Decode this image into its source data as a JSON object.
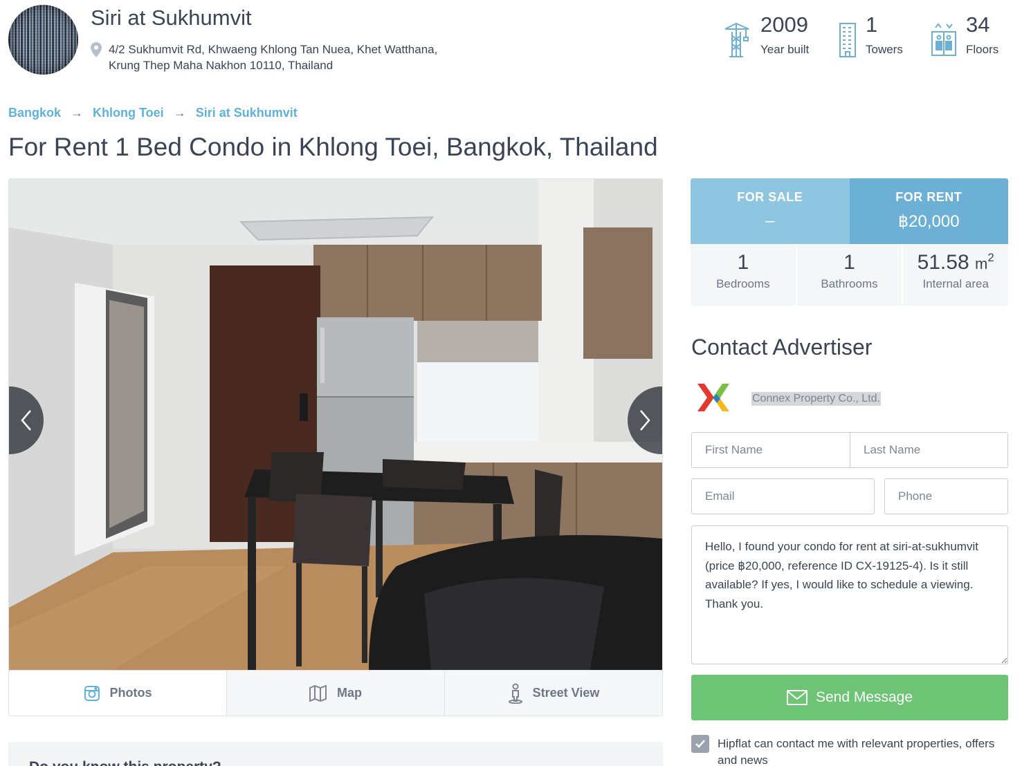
{
  "project": {
    "title": "Siri at Sukhumvit",
    "address_line1": "4/2 Sukhumvit Rd, Khwaeng Khlong Tan Nuea, Khet Watthana,",
    "address_line2": "Krung Thep Maha Nakhon 10110, Thailand"
  },
  "stats": [
    {
      "icon": "crane-icon",
      "value": "2009",
      "label": "Year built"
    },
    {
      "icon": "tower-icon",
      "value": "1",
      "label": "Towers"
    },
    {
      "icon": "elevator-icon",
      "value": "34",
      "label": "Floors"
    }
  ],
  "breadcrumb": {
    "items": [
      "Bangkok",
      "Khlong Toei",
      "Siri at Sukhumvit"
    ],
    "separator": "→"
  },
  "page_title": "For Rent 1 Bed Condo in Khlong Toei, Bangkok, Thailand",
  "gallery": {
    "tabs": [
      {
        "label": "Photos",
        "icon": "camera-icon"
      },
      {
        "label": "Map",
        "icon": "map-icon"
      },
      {
        "label": "Street View",
        "icon": "pegman-icon"
      }
    ]
  },
  "know_box": {
    "title": "Do you know this property?"
  },
  "pricing": {
    "sale_label": "FOR SALE",
    "sale_value": "–",
    "rent_label": "FOR RENT",
    "rent_value": "฿20,000"
  },
  "specs": {
    "bedrooms_value": "1",
    "bedrooms_label": "Bedrooms",
    "bathrooms_value": "1",
    "bathrooms_label": "Bathrooms",
    "area_value": "51.58",
    "area_unit": "m",
    "area_unit_sup": "2",
    "area_label": "Internal area"
  },
  "contact": {
    "title": "Contact Advertiser",
    "agent_name": "Connex Property Co., Ltd.",
    "first_name_placeholder": "First Name",
    "last_name_placeholder": "Last Name",
    "email_placeholder": "Email",
    "phone_placeholder": "Phone",
    "message": "Hello, I found your condo for rent at siri-at-sukhumvit (price ฿20,000, reference ID CX-19125-4). Is it still available? If yes, I would like to schedule a viewing. Thank you.",
    "send_label": "Send Message",
    "consent_text": "Hipflat can contact me with relevant properties, offers and news",
    "consent_checked": true
  },
  "colors": {
    "link": "#5fb3d9",
    "sale_bg": "#8ec5e0",
    "rent_bg": "#6cb0d6",
    "send_bg": "#6dc474",
    "text": "#3a4454"
  }
}
